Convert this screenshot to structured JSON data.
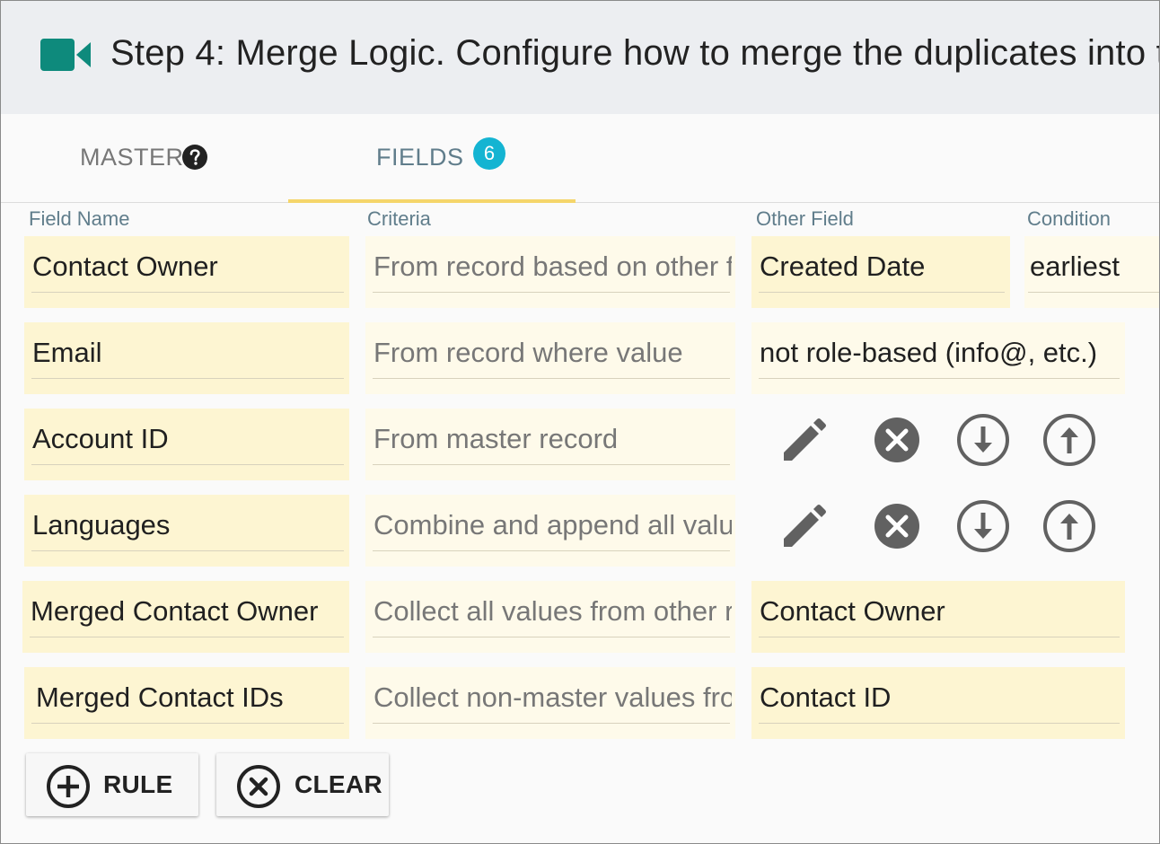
{
  "header": {
    "title": "Step 4: Merge Logic. Configure how to merge the duplicates into the master record",
    "logo_icon": "video-camera-icon",
    "brand_color": "#0e8a7c"
  },
  "tabs": {
    "master_label": "MASTER",
    "fields_label": "FIELDS",
    "fields_count": "6",
    "active": "fields",
    "accent_color": "#f5d56a",
    "badge_color": "#14b4d2"
  },
  "columns": {
    "field_name": "Field Name",
    "criteria": "Criteria",
    "other_field": "Other Field",
    "condition": "Condition"
  },
  "rules": [
    {
      "field": "Contact Owner",
      "criteria": "From record based on other field",
      "other_field": "Created Date",
      "condition": "earliest"
    },
    {
      "field": "Email",
      "criteria": "From record where value",
      "other_field": "not role-based (info@, etc.)"
    },
    {
      "field": "Account ID",
      "criteria": "From master record"
    },
    {
      "field": "Languages",
      "criteria": "Combine and append all values"
    },
    {
      "field": "Merged Contact Owner",
      "criteria": "Collect all values from other records",
      "other_field": "Contact Owner"
    },
    {
      "field": "Merged Contact IDs",
      "criteria": "Collect non-master values from other records",
      "other_field": "Contact ID"
    }
  ],
  "actions": {
    "icons": [
      "pencil-icon",
      "close-circle-icon",
      "arrow-down-circle-icon",
      "arrow-up-circle-icon"
    ],
    "icon_color": "#616161"
  },
  "buttons": {
    "add_rule_label": "RULE",
    "clear_label": "CLEAR"
  }
}
